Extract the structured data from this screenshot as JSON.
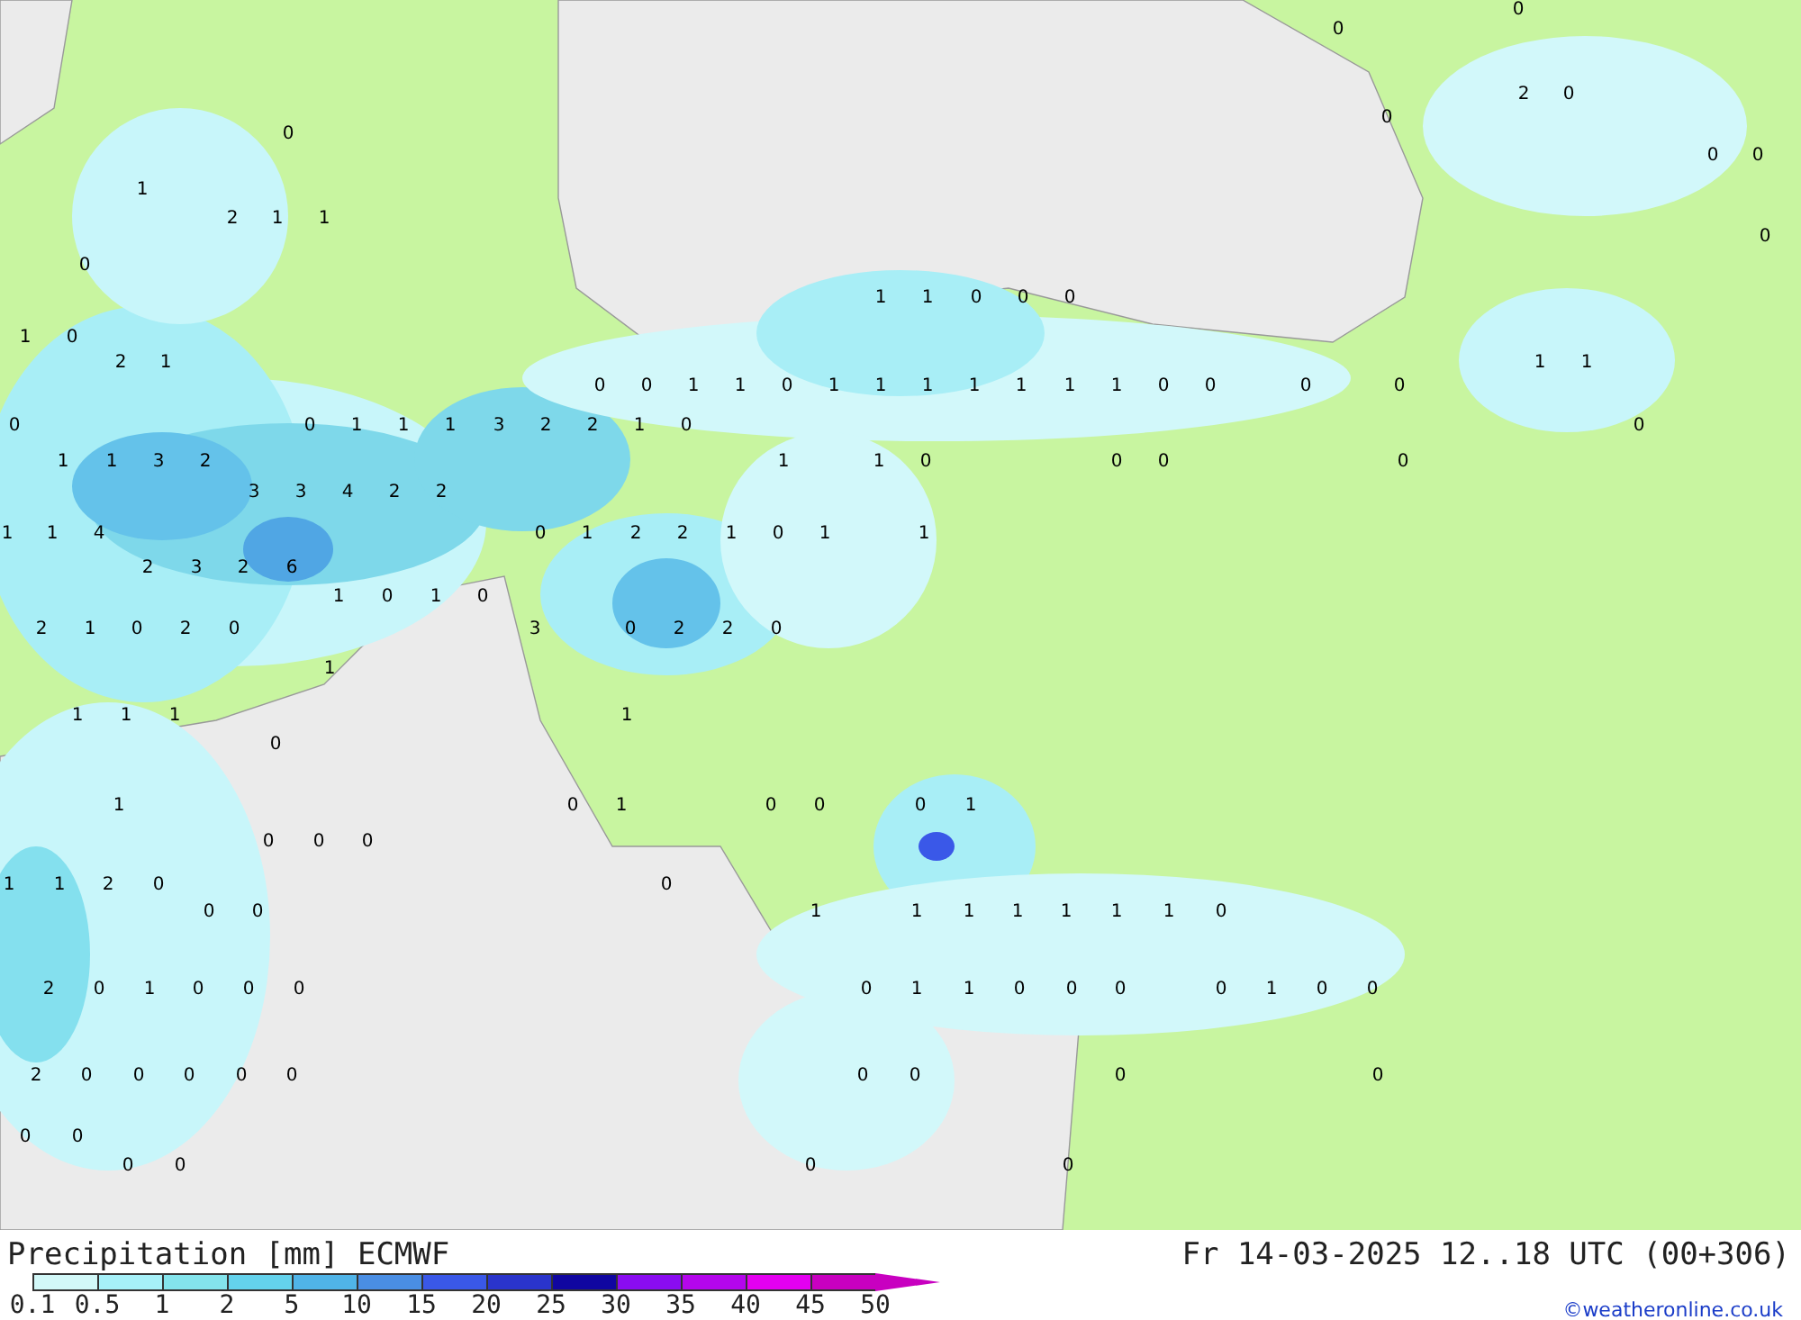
{
  "map": {
    "value_labels": [
      "0",
      "0",
      "2",
      "0",
      "0",
      "0",
      "0",
      "0",
      "1",
      "2",
      "1",
      "1",
      "0",
      "0",
      "1",
      "1",
      "0",
      "0",
      "0",
      "1",
      "0",
      "2",
      "1",
      "1",
      "1",
      "0",
      "0",
      "1",
      "1",
      "0",
      "1",
      "1",
      "1",
      "1",
      "1",
      "1",
      "1",
      "0",
      "0",
      "0",
      "0",
      "0",
      "0",
      "1",
      "1",
      "1",
      "3",
      "2",
      "2",
      "1",
      "0",
      "0",
      "1",
      "1",
      "3",
      "2",
      "1",
      "1",
      "0",
      "0",
      "0",
      "0",
      "3",
      "3",
      "4",
      "2",
      "2",
      "1",
      "1",
      "4",
      "0",
      "1",
      "2",
      "2",
      "1",
      "0",
      "1",
      "1",
      "2",
      "3",
      "2",
      "6",
      "1",
      "0",
      "1",
      "0",
      "2",
      "1",
      "0",
      "2",
      "0",
      "3",
      "0",
      "2",
      "2",
      "0",
      "1",
      "1",
      "1",
      "1",
      "1",
      "0",
      "1",
      "0",
      "1",
      "0",
      "0",
      "0",
      "1",
      "0",
      "0",
      "0",
      "1",
      "1",
      "2",
      "0",
      "0",
      "0",
      "0",
      "1",
      "1",
      "1",
      "1",
      "1",
      "1",
      "1",
      "0",
      "2",
      "0",
      "1",
      "0",
      "0",
      "0",
      "0",
      "1",
      "1",
      "0",
      "0",
      "0",
      "0",
      "1",
      "0",
      "0",
      "2",
      "0",
      "0",
      "0",
      "0",
      "0",
      "0",
      "0",
      "0",
      "0",
      "0",
      "0",
      "0",
      "0",
      "0",
      "0"
    ]
  },
  "caption": {
    "title": "Precipitation [mm] ECMWF",
    "valid_time": "Fr 14-03-2025 12..18 UTC (00+306)",
    "credit": "©weatheronline.co.uk"
  },
  "legend": {
    "segments": [
      {
        "color": "#d2f8f8"
      },
      {
        "color": "#a6f0f8"
      },
      {
        "color": "#84e4ec"
      },
      {
        "color": "#64d2ec"
      },
      {
        "color": "#50b4e8"
      },
      {
        "color": "#4a8ee4"
      },
      {
        "color": "#3a58e8"
      },
      {
        "color": "#2a34cc"
      },
      {
        "color": "#1006a0"
      },
      {
        "color": "#8a0cf0"
      },
      {
        "color": "#b406ec"
      },
      {
        "color": "#e400f0"
      },
      {
        "color": "#c800c0"
      }
    ],
    "ticks": [
      "0.1",
      "0.5",
      "1",
      "2",
      "5",
      "10",
      "15",
      "20",
      "25",
      "30",
      "35",
      "40",
      "45",
      "50"
    ]
  }
}
